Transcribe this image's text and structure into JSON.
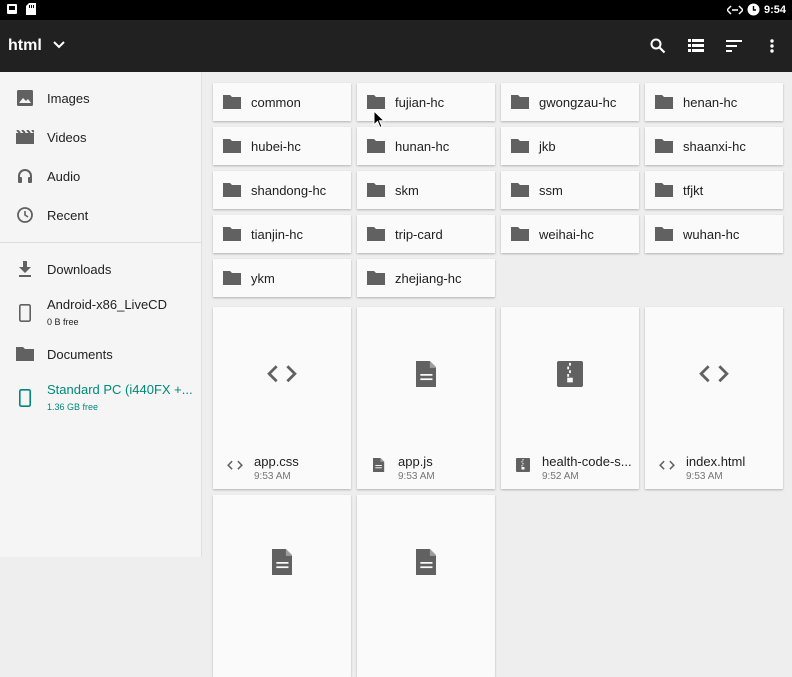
{
  "status_bar": {
    "time": "9:54"
  },
  "toolbar": {
    "title": "html"
  },
  "drawer": {
    "items": [
      {
        "label": "Images",
        "icon": "image-icon"
      },
      {
        "label": "Videos",
        "icon": "movie-icon"
      },
      {
        "label": "Audio",
        "icon": "headphones-icon"
      },
      {
        "label": "Recent",
        "icon": "clock-icon"
      },
      {
        "label": "Downloads",
        "icon": "download-icon"
      },
      {
        "label": "Android-x86_LiveCD",
        "sub": "0 B free",
        "icon": "phone-icon"
      },
      {
        "label": "Documents",
        "icon": "folder-icon"
      },
      {
        "label": "Standard PC (i440FX +...",
        "sub": "1.36 GB free",
        "icon": "phone-icon",
        "active": true
      }
    ]
  },
  "folders": [
    "common",
    "fujian-hc",
    "gwongzau-hc",
    "henan-hc",
    "hubei-hc",
    "hunan-hc",
    "jkb",
    "shaanxi-hc",
    "shandong-hc",
    "skm",
    "ssm",
    "tfjkt",
    "tianjin-hc",
    "trip-card",
    "weihai-hc",
    "wuhan-hc",
    "ykm",
    "zhejiang-hc"
  ],
  "files": [
    {
      "name": "app.css",
      "time": "9:53 AM",
      "icon": "code-icon"
    },
    {
      "name": "app.js",
      "time": "9:53 AM",
      "icon": "document-icon"
    },
    {
      "name": "health-code-s...",
      "time": "9:52 AM",
      "icon": "archive-icon"
    },
    {
      "name": "index.html",
      "time": "9:53 AM",
      "icon": "code-icon"
    },
    {
      "name": "",
      "time": "",
      "icon": "document-icon"
    },
    {
      "name": "",
      "time": "",
      "icon": "document-icon"
    }
  ],
  "colors": {
    "accent": "#00897b",
    "appbar": "#212121",
    "icon_gray": "#616161"
  }
}
